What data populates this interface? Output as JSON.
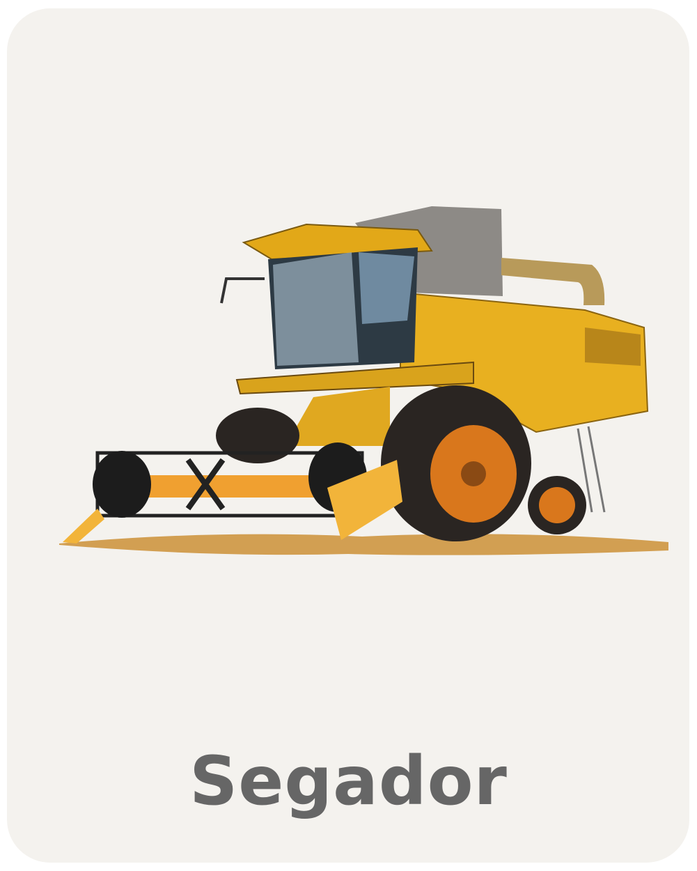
{
  "card": {
    "word": "Segador",
    "image_subject": "combine-harvester",
    "colors": {
      "background": "#f4f2ee",
      "text": "#666666",
      "machine": "#e8b020",
      "wheel": "#d9771c"
    }
  }
}
